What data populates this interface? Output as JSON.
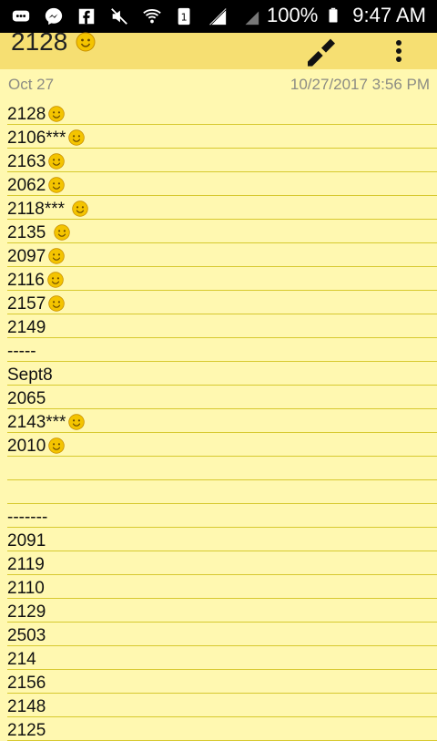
{
  "status": {
    "battery": "100%",
    "time": "9:47 AM",
    "icons": [
      "chat-icon",
      "messenger-icon",
      "facebook-icon",
      "mute-icon",
      "wifi-icon",
      "sim-icon",
      "signal-icon",
      "signal2-icon",
      "battery-icon"
    ]
  },
  "appbar": {
    "title": "2128",
    "title_emoji": "smile",
    "actions": [
      "edit-icon",
      "more-options-icon"
    ]
  },
  "meta": {
    "date": "Oct 27",
    "timestamp": "10/27/2017 3:56 PM"
  },
  "lines": [
    {
      "text": "2128",
      "smile": true
    },
    {
      "text": "2106***",
      "smile": true
    },
    {
      "text": "2163",
      "smile": true
    },
    {
      "text": "2062",
      "smile": true
    },
    {
      "text": "2118*** ",
      "smile": true
    },
    {
      "text": "2135 ",
      "smile": true
    },
    {
      "text": "2097",
      "smile": true
    },
    {
      "text": "2116",
      "smile": true
    },
    {
      "text": "2157",
      "smile": true
    },
    {
      "text": "2149",
      "smile": false
    },
    {
      "text": "-----",
      "smile": false
    },
    {
      "text": "Sept8",
      "smile": false
    },
    {
      "text": "2065",
      "smile": false
    },
    {
      "text": "2143***",
      "smile": true
    },
    {
      "text": "2010",
      "smile": true
    },
    {
      "text": "",
      "smile": false
    },
    {
      "text": "",
      "smile": false
    },
    {
      "text": "-------",
      "smile": false
    },
    {
      "text": "2091",
      "smile": false
    },
    {
      "text": "2119",
      "smile": false
    },
    {
      "text": "2110",
      "smile": false
    },
    {
      "text": "2129",
      "smile": false
    },
    {
      "text": "2503",
      "smile": false
    },
    {
      "text": "214",
      "smile": false
    },
    {
      "text": "2156",
      "smile": false
    },
    {
      "text": "2148",
      "smile": false
    },
    {
      "text": "2125",
      "smile": false
    }
  ]
}
